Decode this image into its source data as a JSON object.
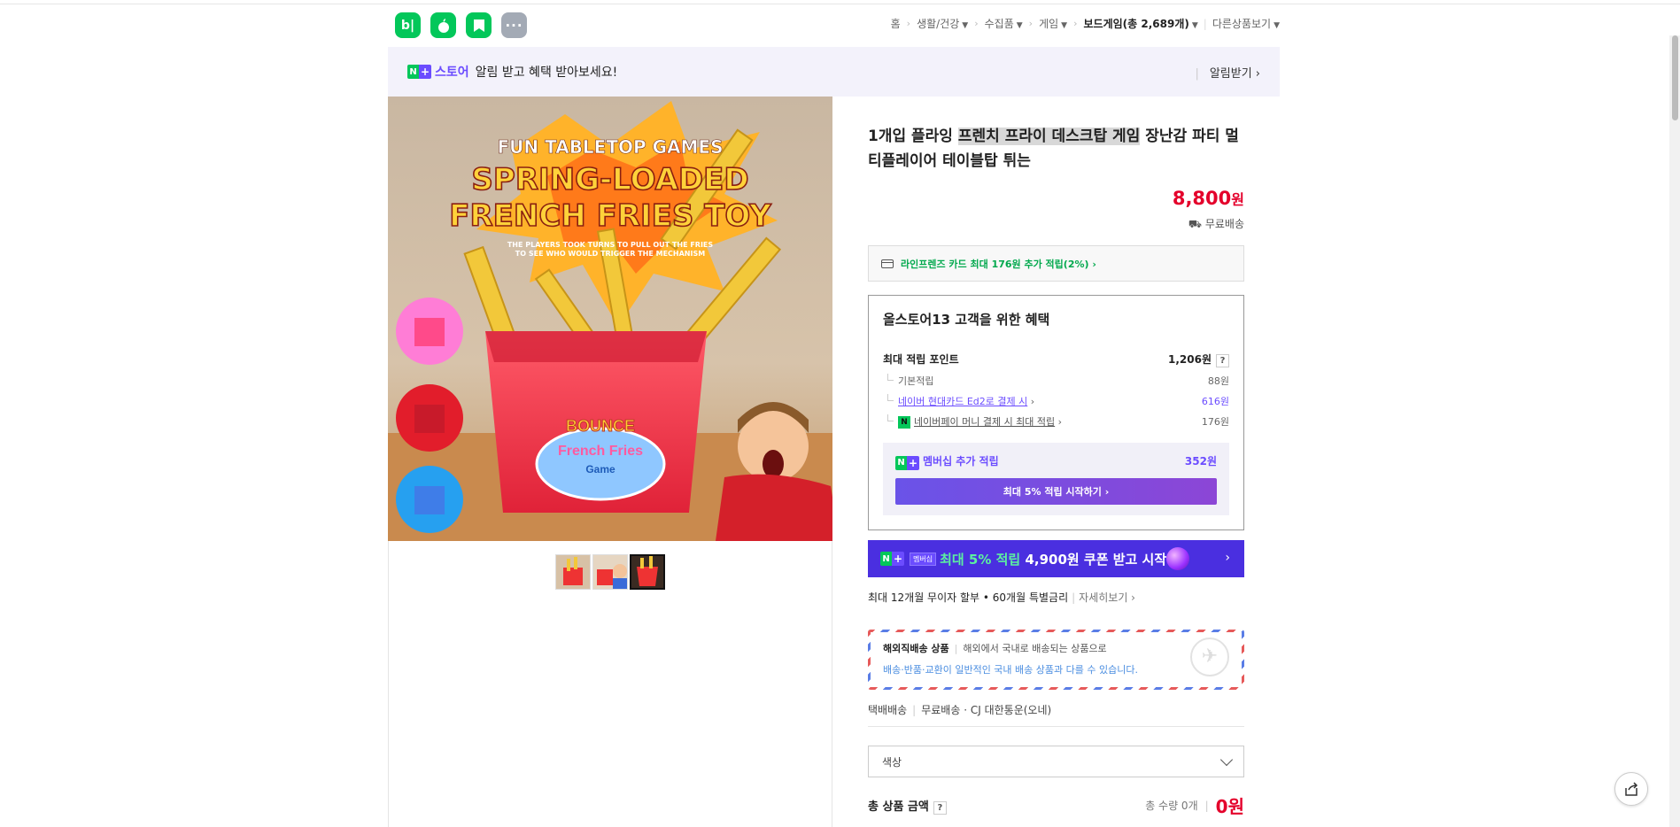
{
  "header": {
    "apps": [
      {
        "icon": "blog-icon",
        "glyph": "b|"
      },
      {
        "icon": "apple-icon",
        "glyph": "●"
      },
      {
        "icon": "bookmark-icon",
        "glyph": "▮"
      },
      {
        "icon": "more-icon",
        "glyph": "···"
      }
    ],
    "breadcrumb": {
      "home": "홈",
      "cat1": "생활/건강",
      "cat2": "수집품",
      "cat3": "게임",
      "cat4": "보드게임(총 2,689개)",
      "other": "다른상품보기"
    }
  },
  "notice": {
    "n": "N",
    "plus": "+",
    "store": "스토어",
    "text": "알림 받고 혜택 받아보세요!",
    "alarm": "알림받기 ›"
  },
  "product": {
    "title_pre": "1개입 플라잉 ",
    "title_hl": "프렌치 프라이 데스크탑 게임",
    "title_post": " 장난감 파티 멀티플레이어 테이블탑 튀는",
    "price": "8,800",
    "price_unit": "원",
    "shipping": "무료배송",
    "image_text": {
      "top": "FUN TABLETOP GAMES",
      "line1": "SPRING-LOADED",
      "line2": "FRENCH FRIES TOY",
      "sub1": "THE PLAYERS TOOK TURNS TO PULL OUT THE FRIES",
      "sub2": "TO SEE WHO WOULD TRIGGER THE MECHANISM",
      "box1": "BOUNCE",
      "box2": "French Fries",
      "box3": "Game"
    }
  },
  "card_benefit": "라인프렌즈 카드 최대 176원 추가 적립(2%) ›",
  "benefits": {
    "heading": "올스토어13 고객을 위한 혜택",
    "max_label": "최대 적립 포인트",
    "max_value": "1,206원",
    "q": "?",
    "rows": [
      {
        "label": "기본적립",
        "value": "88원"
      },
      {
        "label": "네이버 현대카드 Ed2로 결제 시",
        "value": "616원"
      },
      {
        "label": "네이버페이 머니 결제 시 최대 적립",
        "value": "176원"
      }
    ],
    "npay": "N",
    "member_label": "멤버십 추가 적립",
    "member_value": "352원",
    "member_button": "최대 5% 적립 시작하기 ›"
  },
  "banner": {
    "badge": "멤버십",
    "pre": "최대 5% 적립",
    "post": " 4,900원 쿠폰 받고 시작",
    "arrow": "›"
  },
  "installment": {
    "text": "최대 12개월 무이자 할부 • 60개월 특별금리",
    "more": "자세히보기 ›"
  },
  "overseas": {
    "title": "해외직배송 상품",
    "desc": "해외에서 국내로 배송되는 상품으로",
    "note": "배송·반품·교환이 일반적인 국내 배송 상품과 다를 수 있습니다."
  },
  "delivery": {
    "type": "택배배송",
    "fee": "무료배송",
    "courier": "· CJ 대한통운(오네)"
  },
  "option": {
    "label": "색상"
  },
  "total": {
    "label": "총 상품 금액",
    "q": "?",
    "qty": "총 수량 0개",
    "amount": "0원"
  },
  "colors": {
    "naver_green": "#03c75a",
    "price_red": "#e4002b",
    "member_purple": "#6b4cff"
  }
}
